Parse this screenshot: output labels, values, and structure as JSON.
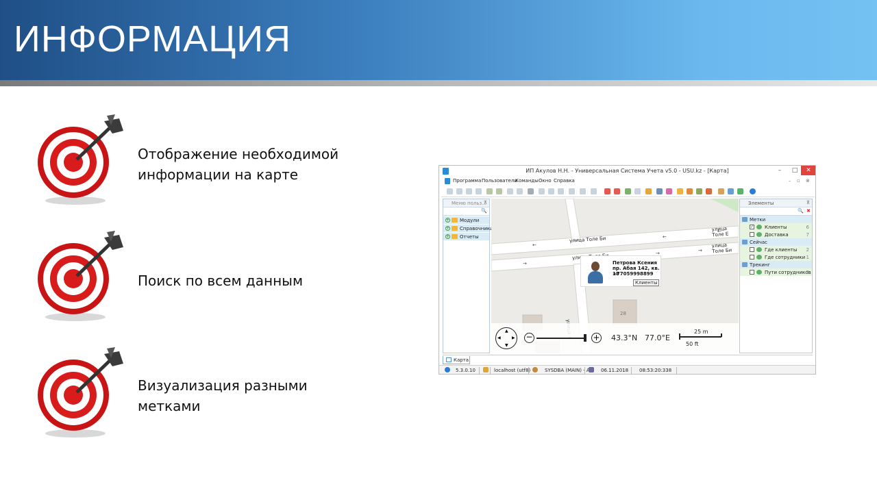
{
  "slide": {
    "title": "ИНФОРМАЦИЯ",
    "bullets": [
      {
        "text": "Отображение необходимой информации на карте",
        "icon": "target-dart-icon"
      },
      {
        "text": "Поиск по всем данным",
        "icon": "target-dart-icon"
      },
      {
        "text": "Визуализация разными метками",
        "icon": "target-dart-icon"
      }
    ]
  },
  "app": {
    "window_title": "ИП Акулов Н.Н. - Универсальная Система Учета v5.0 - USU.kz - [Карта]",
    "menu": [
      "Программа",
      "Пользователи",
      "Команды",
      "Окно",
      "Справка"
    ],
    "left_pane": {
      "title": "Меню польз...",
      "items": [
        "Модули",
        "Справочники",
        "Отчеты"
      ]
    },
    "map": {
      "streets": [
        "улица Толе Би",
        "улица Толе Би",
        "улица Толе Е",
        "улица Толе Би",
        "улица Толе Би"
      ],
      "popup": {
        "name": "Петрова Ксения",
        "address": "пр. Абая 142, кв. 18",
        "phone": "+77059998899",
        "button": "Клиенты"
      },
      "lat": "43.3°N",
      "lon": "77.0°E",
      "scale_top": "25 m",
      "scale_bottom": "50 ft",
      "house_number": "28",
      "street_vertical": "улица Б"
    },
    "right_pane": {
      "title": "Элементы",
      "groups": [
        {
          "name": "Метки",
          "items": [
            {
              "label": "Клиенты",
              "count": "6",
              "checked": true
            },
            {
              "label": "Доставка",
              "count": "7",
              "checked": false
            }
          ]
        },
        {
          "name": "Сейчас",
          "items": [
            {
              "label": "Где клиенты",
              "count": "2",
              "checked": false
            },
            {
              "label": "Где сотрудники",
              "count": "1",
              "checked": false
            }
          ]
        },
        {
          "name": "Трекинг",
          "items": [
            {
              "label": "Пути сотрудников",
              "count": "2",
              "checked": false
            }
          ]
        }
      ]
    },
    "tab": "Карта",
    "status": {
      "version": "5.3.0.10",
      "server": "localhost (utf8)",
      "user": "SYSDBA (MAIN) - A",
      "date": "06.11.2018",
      "time": "08:53:20:338"
    },
    "colors": {
      "header_dark": "#1f4f86",
      "header_light": "#74c1f3",
      "close_button": "#e0443e",
      "green_row": "#e6f4e0",
      "blue_row": "#d9ecf6"
    }
  }
}
